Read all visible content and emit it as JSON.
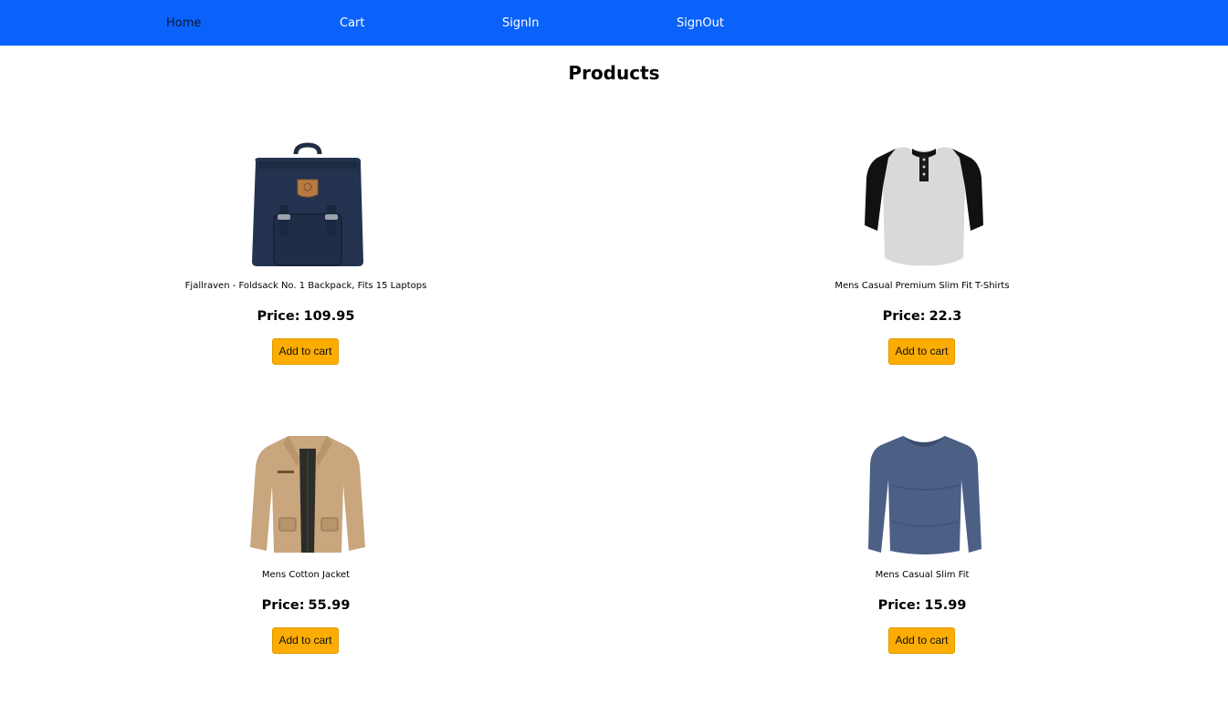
{
  "nav": {
    "items": [
      {
        "label": "Home",
        "active": true
      },
      {
        "label": "Cart"
      },
      {
        "label": "SignIn"
      },
      {
        "label": "SignOut"
      }
    ]
  },
  "page": {
    "title": "Products"
  },
  "products": [
    {
      "name": "Fjallraven - Foldsack No. 1 Backpack, Fits 15 Laptops",
      "price_label": "Price:",
      "price": "109.95",
      "button": "Add to cart",
      "image": "backpack-image"
    },
    {
      "name": "Mens Casual Premium Slim Fit T-Shirts",
      "price_label": "Price:",
      "price": "22.3",
      "button": "Add to cart",
      "image": "henley-tshirt-image"
    },
    {
      "name": "Mens Cotton Jacket",
      "price_label": "Price:",
      "price": "55.99",
      "button": "Add to cart",
      "image": "cotton-jacket-image"
    },
    {
      "name": "Mens Casual Slim Fit",
      "price_label": "Price:",
      "price": "15.99",
      "button": "Add to cart",
      "image": "slim-fit-shirt-image"
    }
  ],
  "colors": {
    "navbar": "#0a62fb",
    "button": "#fdad01"
  }
}
